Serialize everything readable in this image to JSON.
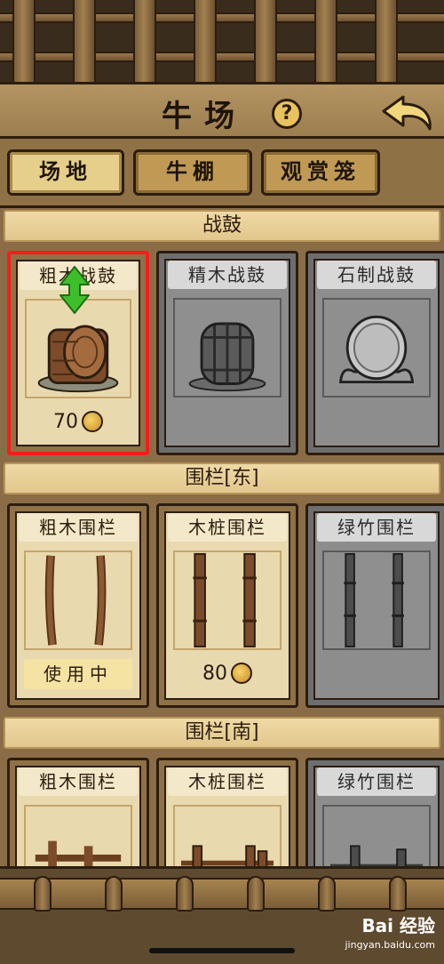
{
  "header": {
    "title": "牛场",
    "help_label": "?"
  },
  "tabs": [
    {
      "label": "场地",
      "active": true
    },
    {
      "label": "牛棚",
      "active": false
    },
    {
      "label": "观赏笼",
      "active": false
    }
  ],
  "sections": [
    {
      "title": "战鼓",
      "items": [
        {
          "name": "粗木战鼓",
          "status": "price",
          "price": "70",
          "locked": false,
          "selected": true,
          "icon": "wooden-drum-icon"
        },
        {
          "name": "精木战鼓",
          "status": "locked",
          "locked": true,
          "icon": "barrel-drum-icon"
        },
        {
          "name": "石制战鼓",
          "status": "locked",
          "locked": true,
          "icon": "stone-drum-icon"
        }
      ]
    },
    {
      "title": "围栏[东]",
      "items": [
        {
          "name": "粗木围栏",
          "status": "in_use",
          "status_label": "使用中",
          "locked": false,
          "icon": "rough-fence-icon"
        },
        {
          "name": "木桩围栏",
          "status": "price",
          "price": "80",
          "locked": false,
          "icon": "stake-fence-icon"
        },
        {
          "name": "绿竹围栏",
          "status": "locked",
          "locked": true,
          "icon": "bamboo-fence-icon"
        }
      ]
    },
    {
      "title": "围栏[南]",
      "items": [
        {
          "name": "粗木围栏",
          "locked": false,
          "icon": "rough-fence-icon"
        },
        {
          "name": "木桩围栏",
          "locked": false,
          "icon": "stake-fence-icon"
        },
        {
          "name": "绿竹围栏",
          "locked": true,
          "icon": "bamboo-fence-icon"
        }
      ]
    }
  ],
  "watermark": {
    "brand": "Bai 经验",
    "url": "jingyan.baidu.com"
  },
  "colors": {
    "selected_border": "#ff1a1a",
    "wood": "#8f7146",
    "parchment": "#e9d9ae",
    "locked": "#6e6e6e"
  }
}
